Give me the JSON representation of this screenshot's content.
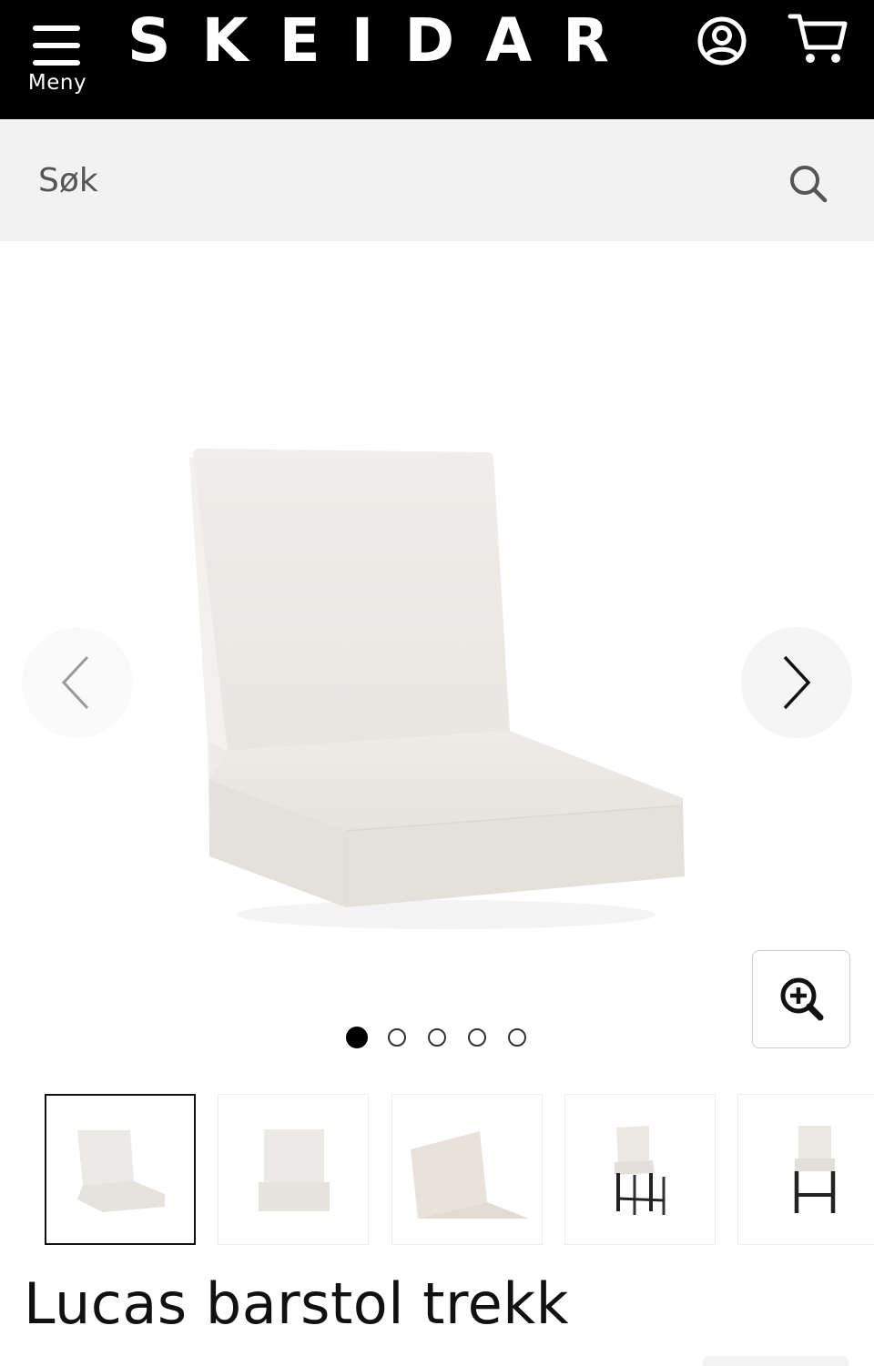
{
  "header": {
    "menu_label": "Meny",
    "logo_text": "SKEIDAR",
    "icons": [
      "hamburger-icon",
      "account-icon",
      "cart-icon"
    ],
    "background_color": "#000000"
  },
  "search": {
    "placeholder": "Søk",
    "icon": "search-icon"
  },
  "gallery": {
    "image_count": 5,
    "active_index": 0,
    "icons": [
      "chevron-left-icon",
      "chevron-right-icon",
      "zoom-in-icon"
    ]
  },
  "thumbnails": {
    "count": 5,
    "selected_index": 0
  },
  "product": {
    "title": "Lucas barstol trekk"
  }
}
